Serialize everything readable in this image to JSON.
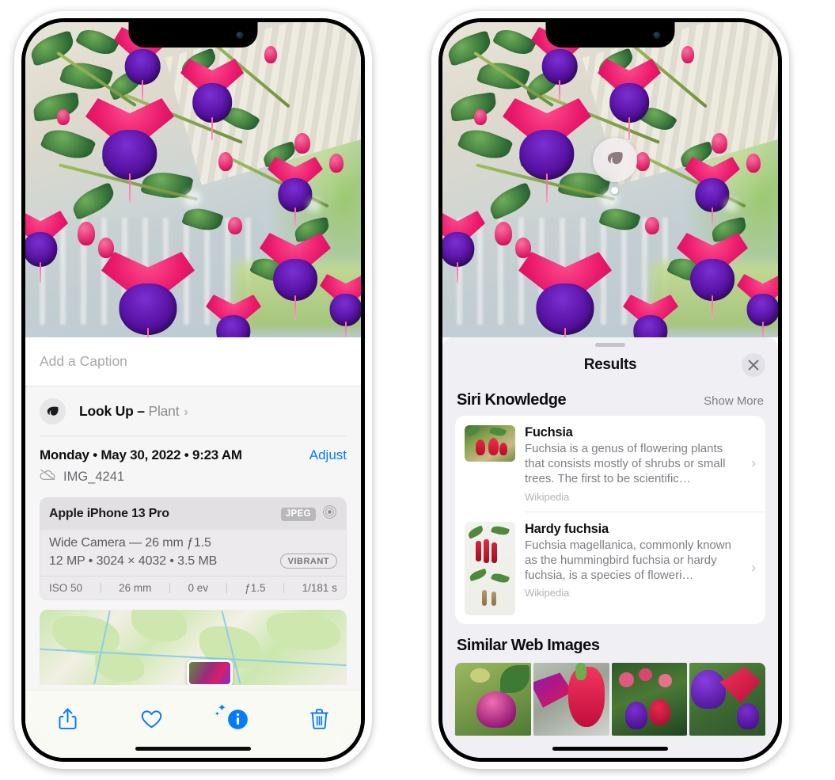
{
  "left_phone": {
    "photo": {
      "alt": "fuchsia-flowers-photo"
    },
    "caption_field": {
      "placeholder": "Add a Caption",
      "value": ""
    },
    "lookup_row": {
      "label": "Look Up –",
      "subject": "Plant",
      "icon": "leaf-icon",
      "chevron": "›"
    },
    "date_row": {
      "date": "Monday • May 30, 2022 • 9:23 AM",
      "adjust_label": "Adjust"
    },
    "filename_row": {
      "filename": "IMG_4241",
      "icon": "cloud-slash-icon"
    },
    "camera_card": {
      "model": "Apple iPhone 13 Pro",
      "format_badge": "JPEG",
      "aperture_icon": "aperture-icon",
      "lens": "Wide Camera — 26 mm ƒ1.5",
      "meta": "12 MP • 3024 × 4032 • 3.5 MB",
      "style_badge": "VIBRANT",
      "exif": [
        "ISO 50",
        "26 mm",
        "0 ev",
        "ƒ1.5",
        "1/181 s"
      ]
    },
    "toolbar": {
      "share_label": "share-button",
      "favorite_label": "favorite-button",
      "info_label": "info-button",
      "delete_label": "delete-button"
    }
  },
  "right_phone": {
    "photo": {
      "alt": "fuchsia-flowers-photo"
    },
    "visual_lookup_badge": {
      "icon": "leaf-icon"
    },
    "sheet": {
      "title": "Results",
      "close_label": "✕",
      "siri_knowledge": {
        "heading": "Siri Knowledge",
        "show_more": "Show More",
        "items": [
          {
            "name": "Fuchsia",
            "description": "Fuchsia is a genus of flowering plants that consists mostly of shrubs or small trees. The first to be scientific…",
            "source": "Wikipedia",
            "chevron": "›"
          },
          {
            "name": "Hardy fuchsia",
            "description": "Fuchsia magellanica, commonly known as the hummingbird fuchsia or hardy fuchsia, is a species of floweri…",
            "source": "Wikipedia",
            "chevron": "›"
          }
        ]
      },
      "similar_web_images": {
        "heading": "Similar Web Images",
        "count": 4
      }
    }
  },
  "colors": {
    "accent_blue": "#047aff",
    "sheet_bg": "#f0eff4",
    "info_bg": "#f6f6f7",
    "card_bg": "#ffffff",
    "secondary_text": "#8e8e93",
    "tertiary_text": "#b3b3ba"
  }
}
